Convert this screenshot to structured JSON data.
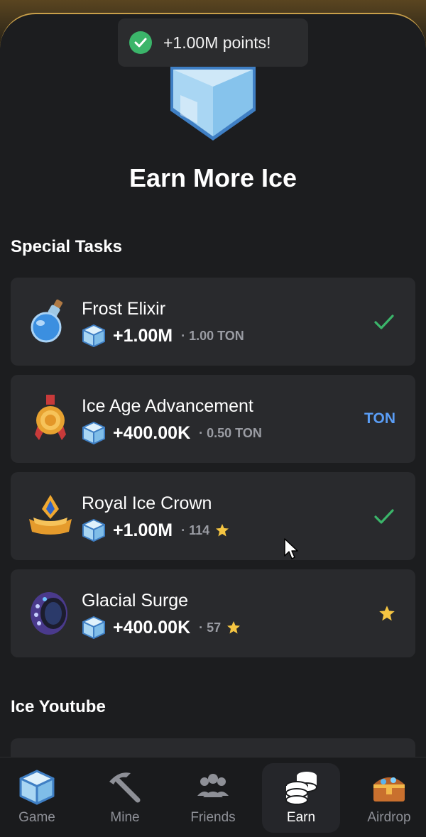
{
  "toast": {
    "message": "+1.00M points!",
    "icon": "check-circle-icon"
  },
  "header": {
    "title": "Earn More Ice",
    "icon": "ice-cube-icon"
  },
  "sections": {
    "special_tasks": "Special Tasks",
    "ice_youtube": "Ice Youtube"
  },
  "tasks": [
    {
      "name": "Frost Elixir",
      "icon": "potion-icon",
      "reward": "+1.00M",
      "price": "· 1.00 TON",
      "price_star": false,
      "status": "done"
    },
    {
      "name": "Ice Age Advancement",
      "icon": "medal-icon",
      "reward": "+400.00K",
      "price": "· 0.50 TON",
      "price_star": false,
      "status": "ton",
      "status_label": "TON"
    },
    {
      "name": "Royal Ice Crown",
      "icon": "crown-icon",
      "reward": "+1.00M",
      "price": "· 114",
      "price_star": true,
      "status": "done"
    },
    {
      "name": "Glacial Surge",
      "icon": "ring-icon",
      "reward": "+400.00K",
      "price": "· 57",
      "price_star": true,
      "status": "star"
    }
  ],
  "nav": [
    {
      "label": "Game",
      "icon": "ice-cube-icon",
      "active": false
    },
    {
      "label": "Mine",
      "icon": "pickaxe-icon",
      "active": false
    },
    {
      "label": "Friends",
      "icon": "friends-icon",
      "active": false
    },
    {
      "label": "Earn",
      "icon": "coins-icon",
      "active": true
    },
    {
      "label": "Airdrop",
      "icon": "treasure-chest-icon",
      "active": false
    }
  ],
  "colors": {
    "background": "#1c1d1f",
    "card": "#292a2d",
    "accent_gold": "#c9a04a",
    "success_green": "#3bb56a",
    "ton_blue": "#5a9df5",
    "star_yellow": "#f5c542"
  }
}
